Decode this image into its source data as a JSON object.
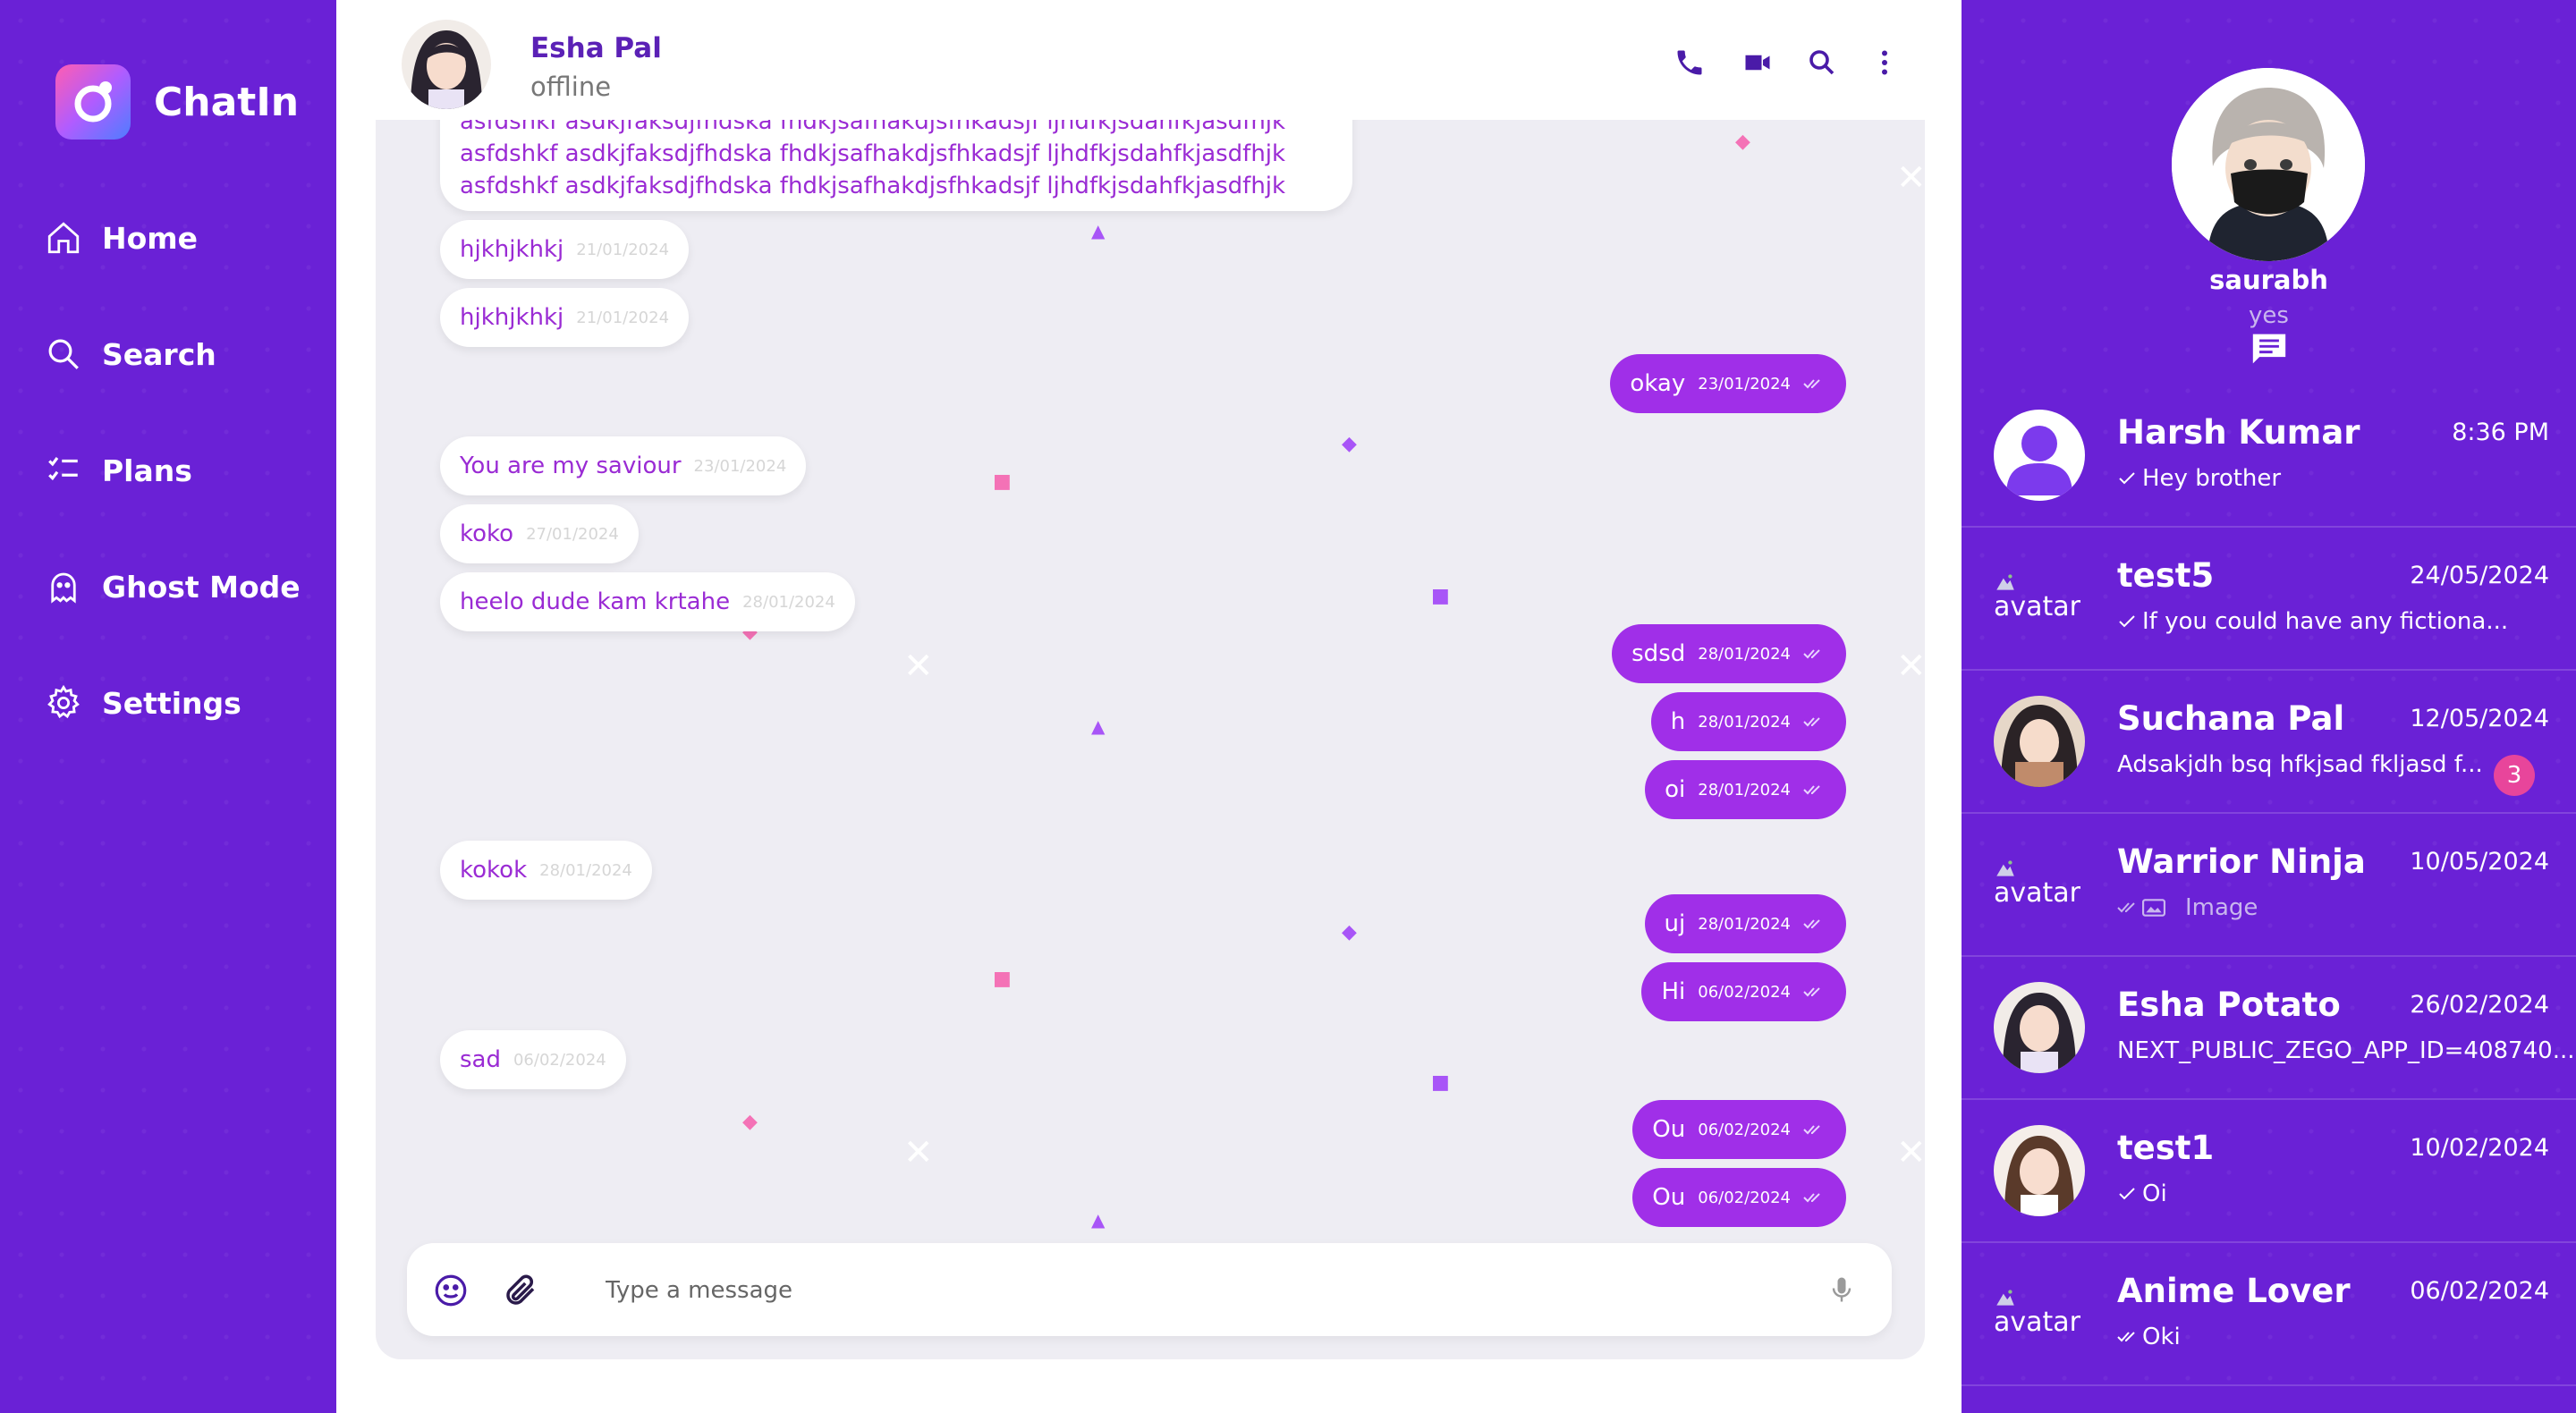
{
  "app": {
    "name": "ChatIn"
  },
  "nav": {
    "items": [
      {
        "label": "Home",
        "icon": "home-icon"
      },
      {
        "label": "Search",
        "icon": "search-icon"
      },
      {
        "label": "Plans",
        "icon": "checklist-icon"
      },
      {
        "label": "Ghost Mode",
        "icon": "ghost-icon"
      },
      {
        "label": "Settings",
        "icon": "gear-icon"
      }
    ]
  },
  "chat": {
    "contact_name": "Esha Pal",
    "contact_status": "offline",
    "long_message_lines": [
      "asfdshkf asdkjfaksdjfhdska fhdkjsafhakdjsfhkadsjf ljhdfkjsdahfkjasdfhjk",
      "asfdshkf asdkjfaksdjfhdska fhdkjsafhakdjsfhkadsjf ljhdfkjsdahfkjasdfhjk",
      "asfdshkf asdkjfaksdjfhdska fhdkjsafhakdjsfhkadsjf ljhdfkjsdahfkjasdfhjk"
    ],
    "messages": [
      {
        "dir": "in",
        "text": "hjkhjkhkj",
        "time": "21/01/2024"
      },
      {
        "dir": "in",
        "text": "hjkhjkhkj",
        "time": "21/01/2024"
      },
      {
        "dir": "out",
        "text": "okay",
        "time": "23/01/2024"
      },
      {
        "dir": "in",
        "text": "You are my saviour",
        "time": "23/01/2024"
      },
      {
        "dir": "in",
        "text": "koko",
        "time": "27/01/2024"
      },
      {
        "dir": "in",
        "text": "heelo dude kam krtahe",
        "time": "28/01/2024"
      },
      {
        "dir": "out",
        "text": "sdsd",
        "time": "28/01/2024"
      },
      {
        "dir": "out",
        "text": "h",
        "time": "28/01/2024"
      },
      {
        "dir": "out",
        "text": "oi",
        "time": "28/01/2024"
      },
      {
        "dir": "in",
        "text": "kokok",
        "time": "28/01/2024"
      },
      {
        "dir": "out",
        "text": "uj",
        "time": "28/01/2024"
      },
      {
        "dir": "out",
        "text": "Hi",
        "time": "06/02/2024"
      },
      {
        "dir": "in",
        "text": "sad",
        "time": "06/02/2024"
      },
      {
        "dir": "out",
        "text": "Ou",
        "time": "06/02/2024"
      },
      {
        "dir": "out",
        "text": "Ou",
        "time": "06/02/2024"
      }
    ],
    "input_placeholder": "Type a message",
    "header_actions": [
      "phone-icon",
      "video-icon",
      "search-icon",
      "more-vertical-icon"
    ]
  },
  "profile": {
    "name": "saurabh",
    "status": "yes"
  },
  "conversations": [
    {
      "name": "Harsh Kumar",
      "time": "8:36 PM",
      "preview": "Hey brother",
      "check": "single",
      "avatar": "default"
    },
    {
      "name": "test5",
      "time": "24/05/2024",
      "preview": "If you could have any fictiona...",
      "check": "single",
      "avatar": "broken",
      "alt": "avatar"
    },
    {
      "name": "Suchana Pal",
      "time": "12/05/2024",
      "preview": "Adsakjdh bsq hfkjsad fkljasd f...",
      "check": "none",
      "avatar": "photo",
      "unread": "3"
    },
    {
      "name": "Warrior Ninja",
      "time": "10/05/2024",
      "preview": "Image",
      "check": "double-image",
      "avatar": "broken",
      "alt": "avatar"
    },
    {
      "name": "Esha Potato",
      "time": "26/02/2024",
      "preview": "NEXT_PUBLIC_ZEGO_APP_ID=408740...",
      "check": "none",
      "avatar": "photo"
    },
    {
      "name": "test1",
      "time": "10/02/2024",
      "preview": "Oi",
      "check": "single",
      "avatar": "photo"
    },
    {
      "name": "Anime Lover",
      "time": "06/02/2024",
      "preview": "Oki",
      "check": "double",
      "avatar": "broken",
      "alt": "avatar"
    }
  ],
  "colors": {
    "brand": "#6a21d6",
    "accent": "#a02fe8",
    "incoming_text": "#9a2bd4",
    "badge": "#e8459b"
  }
}
